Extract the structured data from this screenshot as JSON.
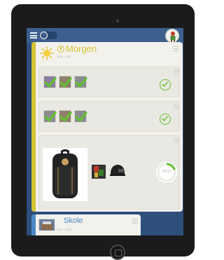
{
  "activity": {
    "title": "Morgen",
    "subtitle": "6:00 - 7:30"
  },
  "timer": {
    "time": "09:50",
    "progress": 0.2
  },
  "next_activity": {
    "title": "Skole",
    "subtitle": "8:00 - 13:00"
  },
  "colors": {
    "accent_yellow": "#d6c334",
    "accent_blue": "#4b88c6",
    "check_green": "#62c12e",
    "screen_bg": "#2e4e7b"
  },
  "icons": [
    "menu-icon",
    "toggle-switch",
    "avatar",
    "sun-icon",
    "clock-icon",
    "check-icon",
    "done-circle-icon",
    "hamburger-icon",
    "backpack-image",
    "helmet-image",
    "timer-icon"
  ]
}
